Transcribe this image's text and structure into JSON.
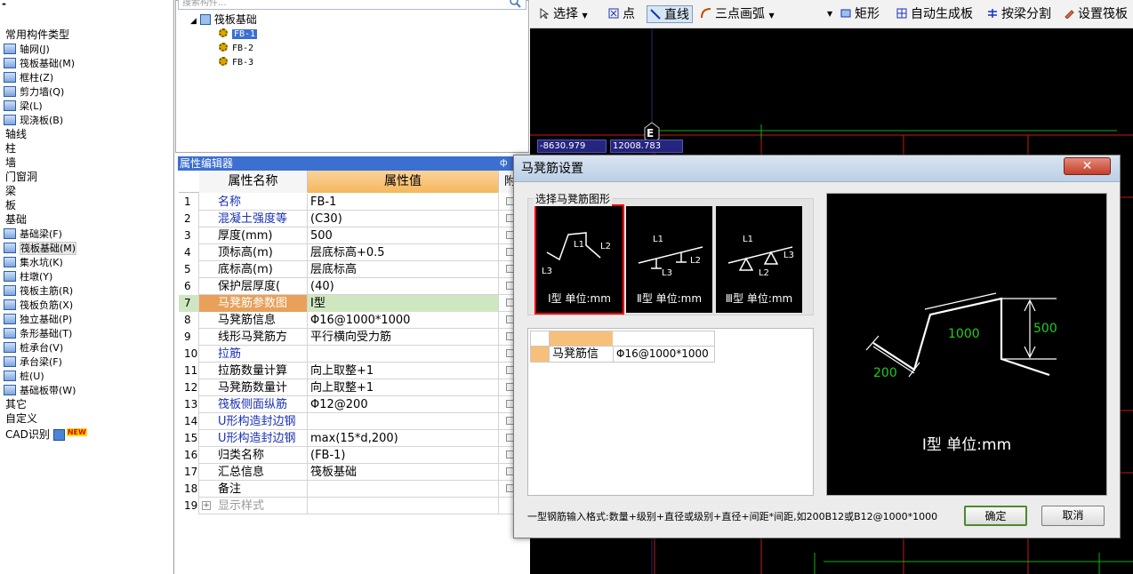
{
  "left_panel": {
    "top_mark": "-",
    "rows": [
      {
        "type": "cat",
        "label": "常用构件类型"
      },
      {
        "type": "item",
        "label": "轴网(J)"
      },
      {
        "type": "item",
        "label": "筏板基础(M)"
      },
      {
        "type": "item",
        "label": "框柱(Z)"
      },
      {
        "type": "item",
        "label": "剪力墙(Q)"
      },
      {
        "type": "item",
        "label": "梁(L)"
      },
      {
        "type": "item",
        "label": "现浇板(B)"
      },
      {
        "type": "cat",
        "label": "轴线"
      },
      {
        "type": "cat",
        "label": "柱"
      },
      {
        "type": "cat",
        "label": "墙"
      },
      {
        "type": "cat",
        "label": "门窗洞"
      },
      {
        "type": "cat",
        "label": "梁"
      },
      {
        "type": "cat",
        "label": "板"
      },
      {
        "type": "cat",
        "label": "基础"
      },
      {
        "type": "item",
        "label": "基础梁(F)"
      },
      {
        "type": "item",
        "label": "筏板基础(M)",
        "selected": true
      },
      {
        "type": "item",
        "label": "集水坑(K)"
      },
      {
        "type": "item",
        "label": "柱墩(Y)"
      },
      {
        "type": "item",
        "label": "筏板主筋(R)"
      },
      {
        "type": "item",
        "label": "筏板负筋(X)"
      },
      {
        "type": "item",
        "label": "独立基础(P)"
      },
      {
        "type": "item",
        "label": "条形基础(T)"
      },
      {
        "type": "item",
        "label": "桩承台(V)"
      },
      {
        "type": "item",
        "label": "承台梁(F)"
      },
      {
        "type": "item",
        "label": "桩(U)"
      },
      {
        "type": "item",
        "label": "基础板带(W)"
      },
      {
        "type": "cat",
        "label": "其它"
      },
      {
        "type": "cat",
        "label": "自定义"
      }
    ],
    "cad_label": "CAD识别",
    "new_badge": "NEW"
  },
  "tree": {
    "search_placeholder": "搜索构件...",
    "root": "筏板基础",
    "children": [
      "FB-1",
      "FB-2",
      "FB-3"
    ]
  },
  "property_editor": {
    "title": "属性编辑器",
    "pin": "ф",
    "col_name": "属性名称",
    "col_value": "属性值",
    "col_extra": "附",
    "rows": [
      {
        "n": "1",
        "k": "名称",
        "v": "FB-1",
        "style": "blue"
      },
      {
        "n": "2",
        "k": "混凝土强度等",
        "v": "(C30)",
        "style": "blue"
      },
      {
        "n": "3",
        "k": "厚度(mm)",
        "v": "500",
        "style": ""
      },
      {
        "n": "4",
        "k": "顶标高(m)",
        "v": "层底标高+0.5",
        "style": ""
      },
      {
        "n": "5",
        "k": "底标高(m)",
        "v": "层底标高",
        "style": ""
      },
      {
        "n": "6",
        "k": "保护层厚度(",
        "v": "(40)",
        "style": ""
      },
      {
        "n": "7",
        "k": "马凳筋参数图",
        "v": "Ⅰ型",
        "style": "hl"
      },
      {
        "n": "8",
        "k": "马凳筋信息",
        "v": "Φ16@1000*1000",
        "style": ""
      },
      {
        "n": "9",
        "k": "线形马凳筋方",
        "v": "平行横向受力筋",
        "style": ""
      },
      {
        "n": "10",
        "k": "拉筋",
        "v": "",
        "style": "blue"
      },
      {
        "n": "11",
        "k": "拉筋数量计算",
        "v": "向上取整+1",
        "style": ""
      },
      {
        "n": "12",
        "k": "马凳筋数量计",
        "v": "向上取整+1",
        "style": ""
      },
      {
        "n": "13",
        "k": "筏板侧面纵筋",
        "v": "Φ12@200",
        "style": "blue"
      },
      {
        "n": "14",
        "k": "U形构造封边钢",
        "v": "",
        "style": "blue"
      },
      {
        "n": "15",
        "k": "U形构造封边钢",
        "v": "max(15*d,200)",
        "style": "blue"
      },
      {
        "n": "16",
        "k": "归类名称",
        "v": "(FB-1)",
        "style": ""
      },
      {
        "n": "17",
        "k": "汇总信息",
        "v": "筏板基础",
        "style": ""
      },
      {
        "n": "18",
        "k": "备注",
        "v": "",
        "style": ""
      },
      {
        "n": "19",
        "k": "显示样式",
        "v": "",
        "style": "grey"
      }
    ]
  },
  "toolbar": {
    "select": "选择",
    "point": "点",
    "line": "直线",
    "arc": "三点画弧",
    "rect": "矩形",
    "auto_gen": "自动生成板",
    "split_by_beam": "按梁分割",
    "set_slab": "设置筏板"
  },
  "canvas": {
    "axis_label": "E",
    "coord_x": "-8630.979",
    "coord_y": "12008.783"
  },
  "dialog": {
    "title": "马凳筋设置",
    "close": "✕",
    "shape_group_label": "选择马凳筋图形",
    "shapes": [
      {
        "caption": "Ⅰ型 单位:mm",
        "selected": true
      },
      {
        "caption": "Ⅱ型 单位:mm",
        "selected": false
      },
      {
        "caption": "Ⅲ型 单位:mm",
        "selected": false
      }
    ],
    "table": {
      "row_label": "马凳筋信",
      "row_value": "Φ16@1000*1000"
    },
    "preview": {
      "caption": "Ⅰ型 单位:mm",
      "dim_500": "500",
      "dim_1000": "1000",
      "dim_200": "200"
    },
    "hint": "一型钢筋输入格式:数量+级别+直径或级别+直径+间距*间距,如200B12或B12@1000*1000",
    "ok": "确定",
    "cancel": "取消"
  },
  "colors": {
    "accent_blue": "#3b6fd0",
    "highlight_orange": "#f4b75d",
    "canvas_bg": "#000000",
    "grid_red": "#c81a1a",
    "grid_green": "#0fb20f",
    "preview_green": "#22cc22"
  }
}
